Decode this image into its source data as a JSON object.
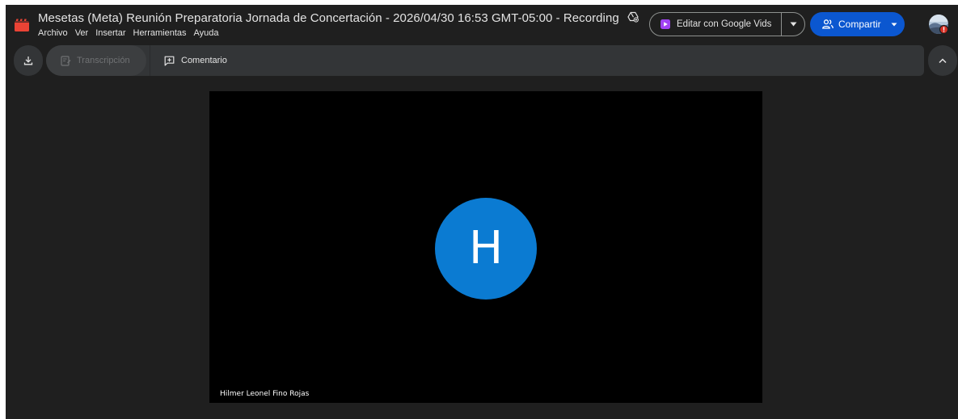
{
  "header": {
    "title": "Mesetas (Meta) Reunión Preparatoria Jornada de Concertación  - 2026/04/30 16:53 GMT-05:00 - Recording",
    "menu": [
      "Archivo",
      "Ver",
      "Insertar",
      "Herramientas",
      "Ayuda"
    ],
    "vids_label": "Editar con Google Vids",
    "share_label": "Compartir"
  },
  "toolbar": {
    "transcript_label": "Transcripción",
    "comment_label": "Comentario"
  },
  "video": {
    "initial": "H",
    "participant_name": "Hilmer Leonel Fino Rojas"
  },
  "icons": {
    "app": "video-clapper-icon",
    "shared": "shared-drive-icon",
    "vids": "google-vids-icon",
    "share": "people-icon",
    "download": "download-icon",
    "transcript": "transcript-icon",
    "comment": "add-comment-icon",
    "collapse": "chevron-up-icon"
  },
  "colors": {
    "background": "#1f1f1f",
    "app_logo": "#ea4335",
    "share_button": "#0b57d0",
    "participant_avatar": "#0b7bd2",
    "vids_icon": "#a142f4"
  }
}
